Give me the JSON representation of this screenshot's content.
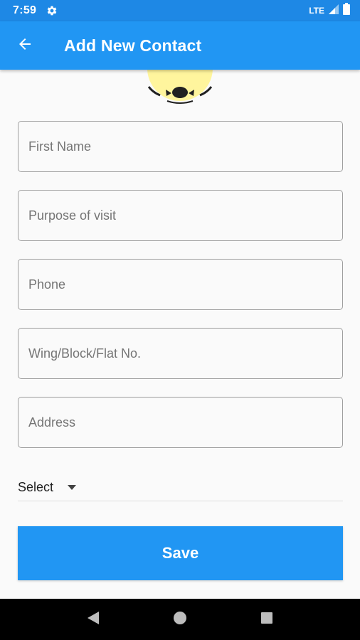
{
  "status_bar": {
    "time": "7:59",
    "network": "LTE"
  },
  "app_bar": {
    "title": "Add New Contact"
  },
  "form": {
    "first_name_placeholder": "First Name",
    "purpose_placeholder": "Purpose of visit",
    "phone_placeholder": "Phone",
    "flat_placeholder": "Wing/Block/Flat No.",
    "address_placeholder": "Address",
    "select_label": "Select",
    "save_label": "Save"
  },
  "colors": {
    "primary": "#2196f3",
    "status_bar": "#1e88e5",
    "avatar": "#fff59d"
  },
  "icons": {
    "back": "arrow-left-icon",
    "settings": "gear-icon",
    "signal": "signal-icon",
    "battery": "battery-icon",
    "dropdown": "caret-down-icon",
    "nav_back": "triangle-back-icon",
    "nav_home": "circle-home-icon",
    "nav_recents": "square-recents-icon"
  }
}
